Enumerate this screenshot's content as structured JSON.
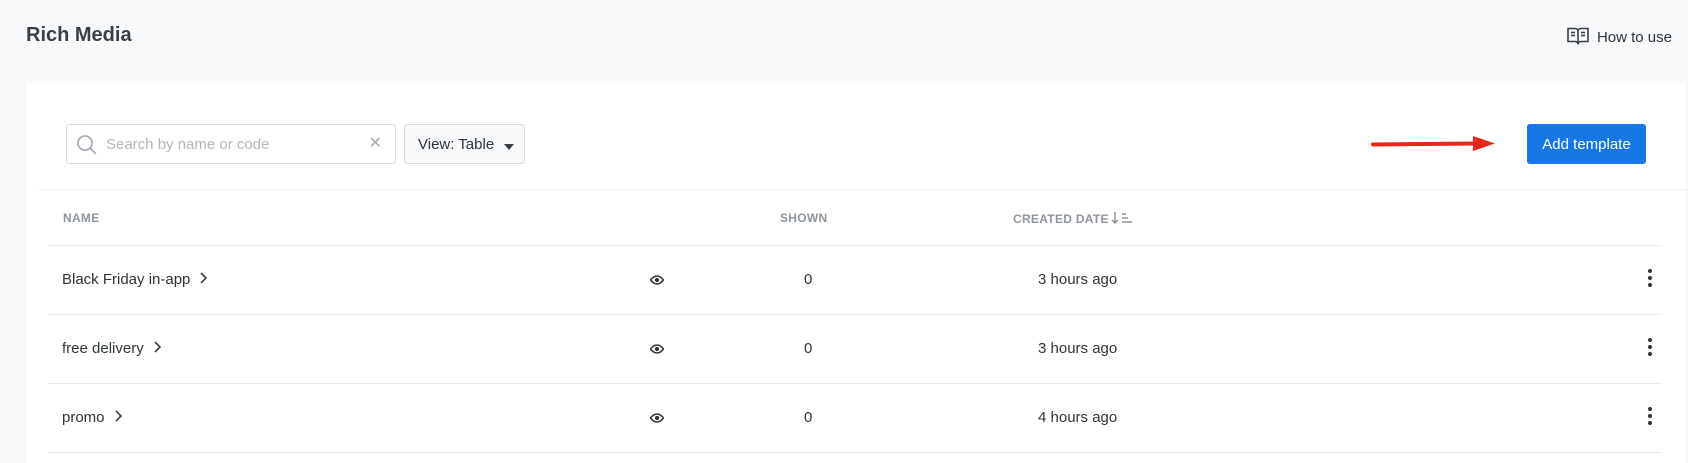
{
  "header": {
    "title": "Rich Media",
    "how_to_label": "How to use"
  },
  "toolbar": {
    "search_placeholder": "Search by name or code",
    "view_label": "View: Table",
    "add_label": "Add template"
  },
  "table": {
    "columns": {
      "name": "NAME",
      "shown": "SHOWN",
      "created": "CREATED DATE"
    },
    "rows": [
      {
        "name": "Black Friday in-app",
        "shown": "0",
        "created": "3 hours ago"
      },
      {
        "name": "free delivery",
        "shown": "0",
        "created": "3 hours ago"
      },
      {
        "name": "promo",
        "shown": "0",
        "created": "4 hours ago"
      }
    ]
  },
  "colors": {
    "accent": "#1677e5",
    "arrow": "#e8271c"
  }
}
